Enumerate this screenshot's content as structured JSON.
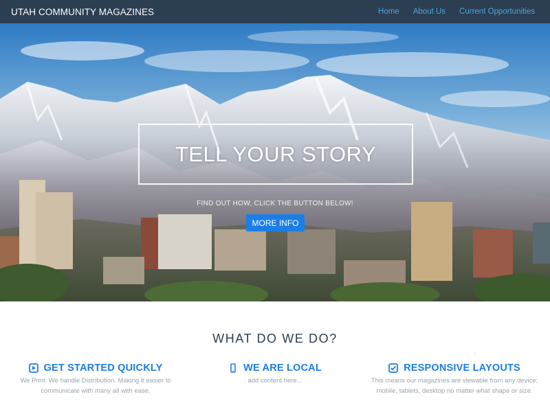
{
  "navbar": {
    "brand": "UTAH COMMUNITY MAGAZINES",
    "links": [
      "Home",
      "About Us",
      "Current Opportunities"
    ]
  },
  "hero": {
    "title": "TELL YOUR STORY",
    "subtitle": "FIND OUT HOW, CLICK THE BUTTON BELOW!",
    "button_label": "MORE INFO"
  },
  "section": {
    "title": "WHAT DO WE DO?",
    "features": [
      {
        "icon": "play-square-icon",
        "title": "GET STARTED QUICKLY",
        "lines": [
          "We Print. We handle Distribution. Making it easier to",
          "communicate with many all with ease."
        ]
      },
      {
        "icon": "mobile-icon",
        "title": "WE ARE LOCAL",
        "lines": [
          "add content here..."
        ]
      },
      {
        "icon": "check-square-icon",
        "title": "RESPONSIVE LAYOUTS",
        "lines": [
          "This means our magazines are viewable from any device;",
          "mobile, tablets, desktop no matter what shape or size."
        ]
      }
    ]
  },
  "colors": {
    "navbar_bg": "#2b3e52",
    "nav_link": "#4ea6de",
    "accent": "#1a7ee6",
    "body_text": "#9aa3ab",
    "heading": "#2b3e52"
  }
}
